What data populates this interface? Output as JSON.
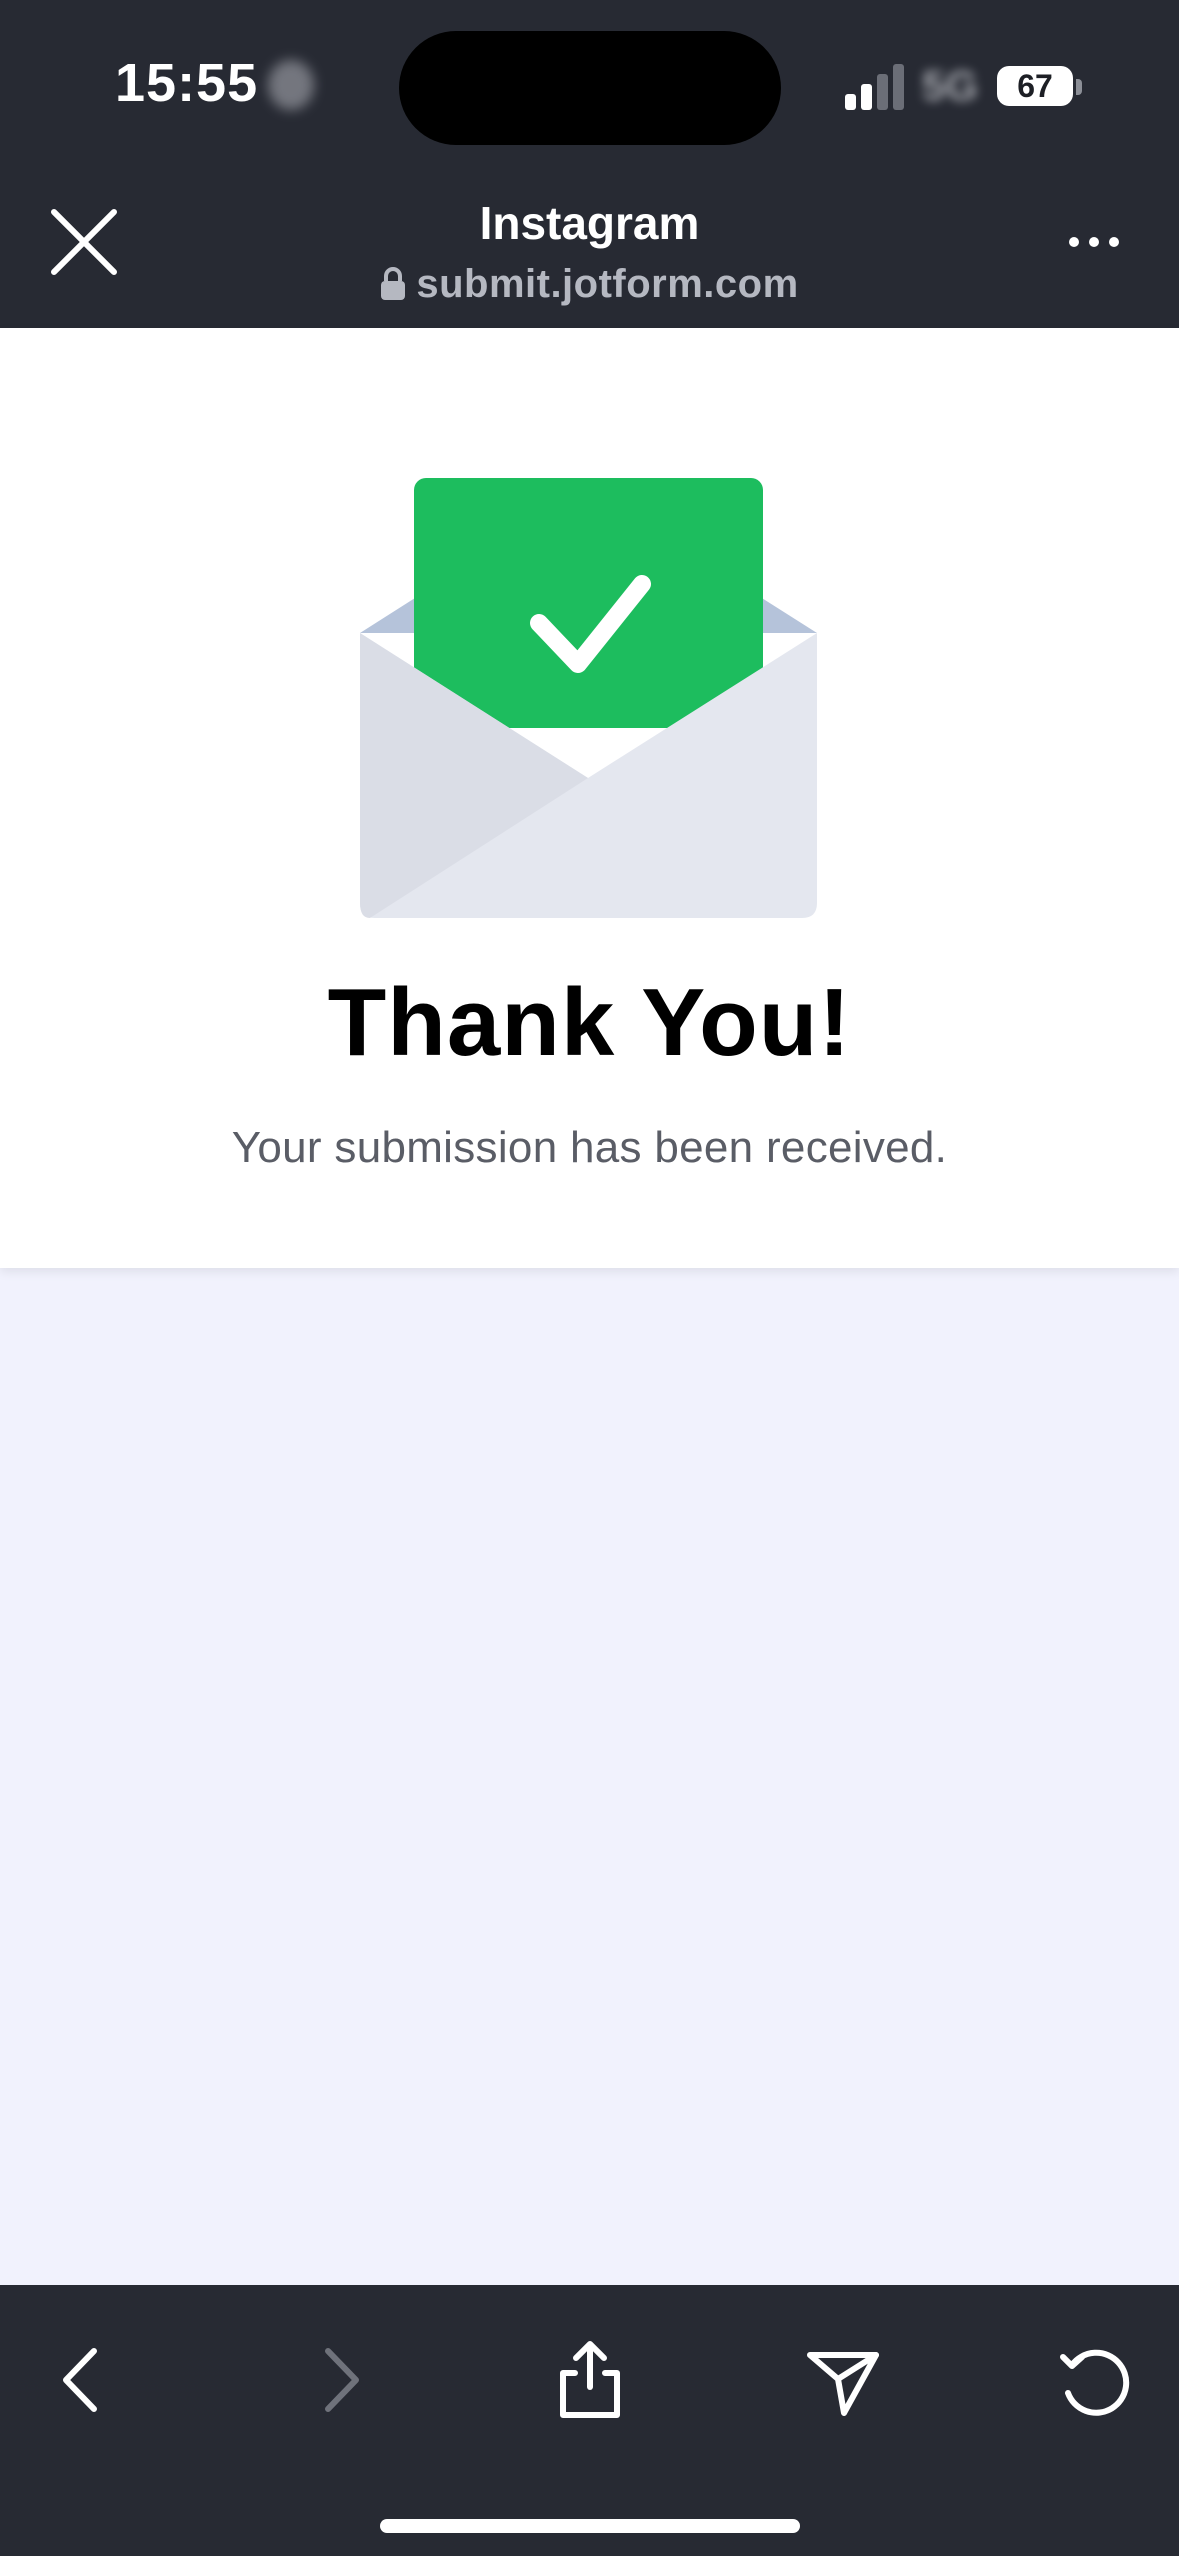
{
  "status_bar": {
    "time": "15:55",
    "network": "5G",
    "battery": "67"
  },
  "browser_header": {
    "title": "Instagram",
    "url": "submit.jotform.com"
  },
  "content": {
    "heading": "Thank You!",
    "message": "Your submission has been received."
  },
  "toolbar": {
    "back_enabled": true,
    "forward_enabled": false
  },
  "icons": {
    "close": "close-icon",
    "more": "more-icon",
    "lock": "lock-icon",
    "back": "back-arrow-icon",
    "forward": "forward-arrow-icon",
    "share": "share-icon",
    "send": "send-icon",
    "reload": "reload-icon",
    "illustration": "envelope-check-icon"
  },
  "colors": {
    "chrome_background": "#272a33",
    "page_background": "#f1f2fd",
    "card_background": "#ffffff",
    "success_green": "#1dbd5e",
    "envelope_body": "#e4e7ef",
    "envelope_flap": "#b5c3da",
    "url_text": "#b5b8c1",
    "message_text": "#5a5d66"
  }
}
